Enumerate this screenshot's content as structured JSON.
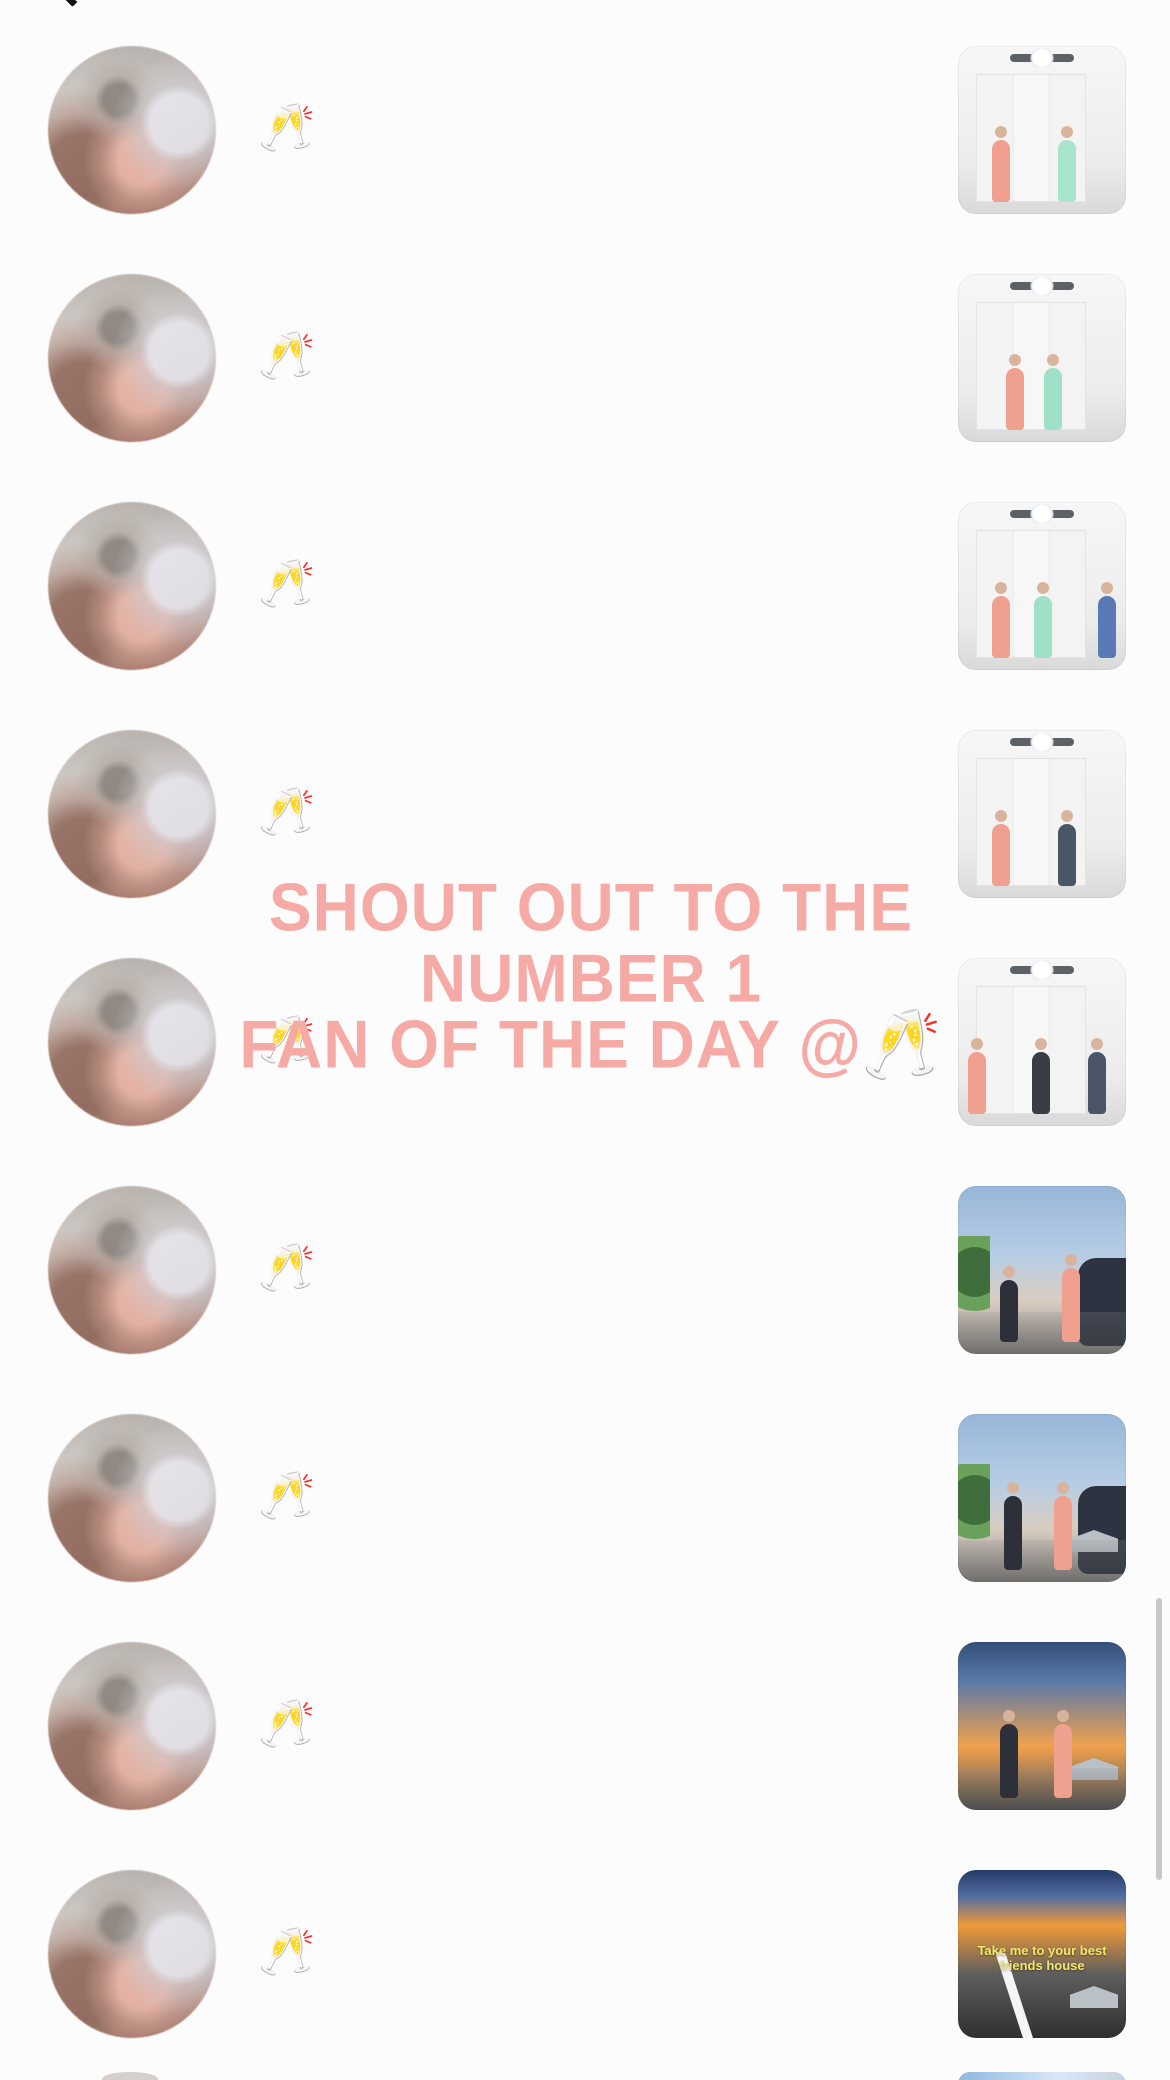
{
  "header": {
    "back_icon": "back-icon",
    "title_icon": "title-fragment"
  },
  "rows": [
    {
      "message": "🥂",
      "thumbnail_type": "indoor"
    },
    {
      "message": "🥂",
      "thumbnail_type": "indoor"
    },
    {
      "message": "🥂",
      "thumbnail_type": "indoor"
    },
    {
      "message": "🥂",
      "thumbnail_type": "indoor"
    },
    {
      "message": "🥂",
      "thumbnail_type": "indoor"
    },
    {
      "message": "🥂",
      "thumbnail_type": "outdoor"
    },
    {
      "message": "🥂",
      "thumbnail_type": "outdoor"
    },
    {
      "message": "🥂",
      "thumbnail_type": "sunset"
    },
    {
      "message": "🥂",
      "thumbnail_type": "road",
      "thumbnail_caption": "Take me to your best friends house"
    }
  ],
  "overlay": {
    "line1": "Shout out to the Number 1",
    "line2": "fan of the day @🥂"
  },
  "colors": {
    "overlay_text": "#f6aaa5",
    "background": "#fdfcfc"
  }
}
